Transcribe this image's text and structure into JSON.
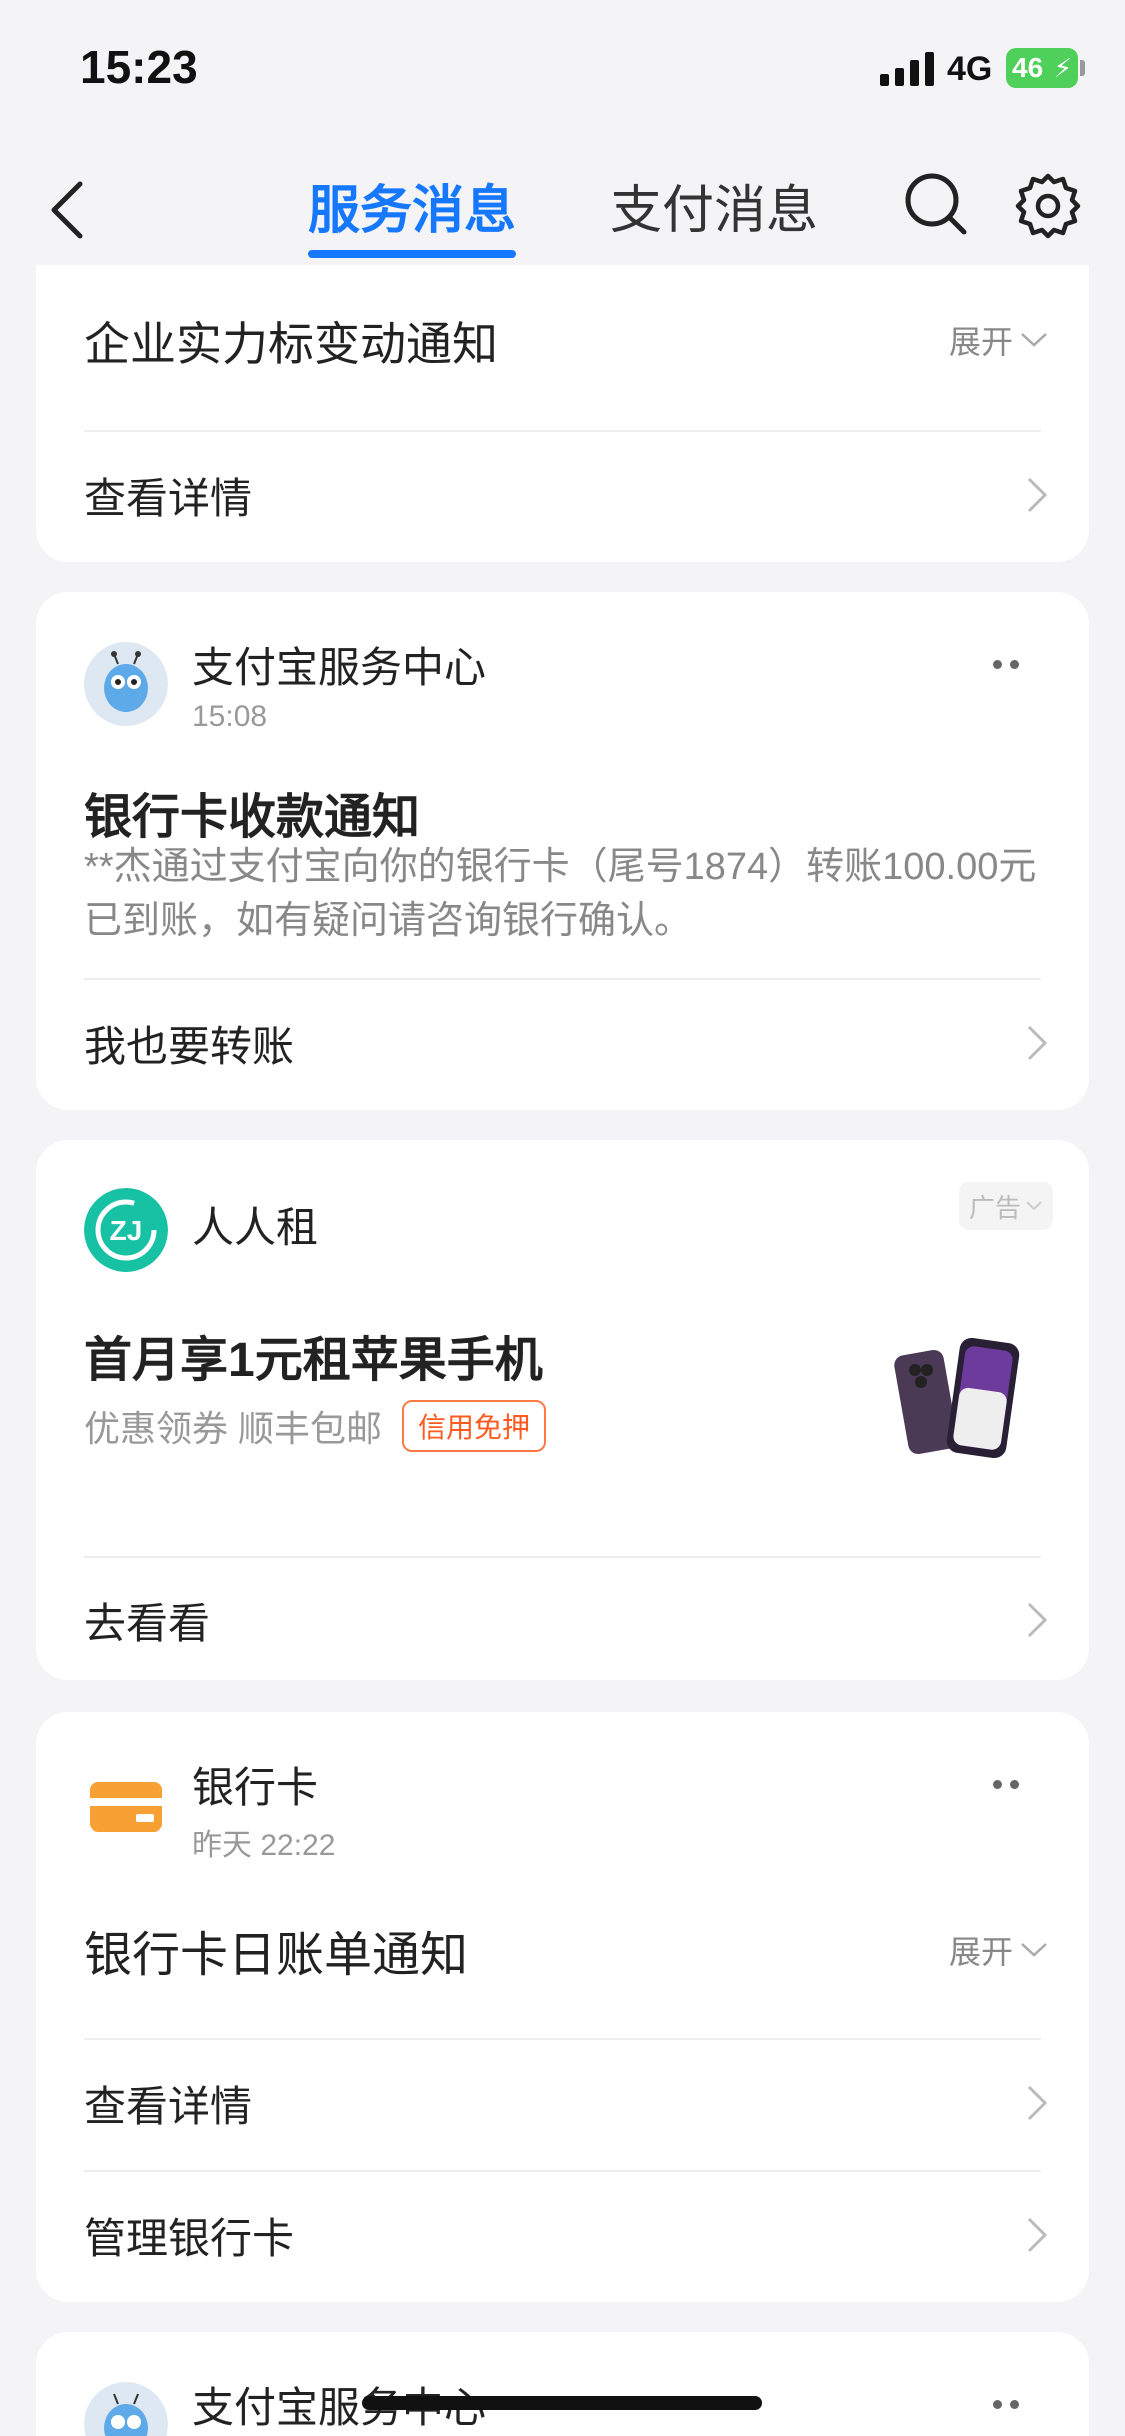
{
  "status_bar": {
    "time": "15:23",
    "network": "4G",
    "battery": "46"
  },
  "nav": {
    "tabs": [
      {
        "label": "服务消息",
        "active": true
      },
      {
        "label": "支付消息",
        "active": false
      }
    ],
    "accent_color": "#1677ff"
  },
  "cards": [
    {
      "title": "企业实力标变动通知",
      "expand_label": "展开",
      "links": [
        "查看详情"
      ]
    },
    {
      "sender": "支付宝服务中心",
      "time": "15:08",
      "title": "银行卡收款通知",
      "body": "**杰通过支付宝向你的银行卡（尾号1874）转账100.00元已到账，如有疑问请咨询银行确认。",
      "links": [
        "我也要转账"
      ]
    },
    {
      "sender": "人人租",
      "ad_label": "广告",
      "title": "首月享1元租苹果手机",
      "subtitle": "优惠领券 顺丰包邮",
      "tag": "信用免押",
      "links": [
        "去看看"
      ]
    },
    {
      "sender": "银行卡",
      "time": "昨天 22:22",
      "title": "银行卡日账单通知",
      "expand_label": "展开",
      "links": [
        "查看详情",
        "管理银行卡"
      ]
    },
    {
      "sender": "支付宝服务中心"
    }
  ]
}
